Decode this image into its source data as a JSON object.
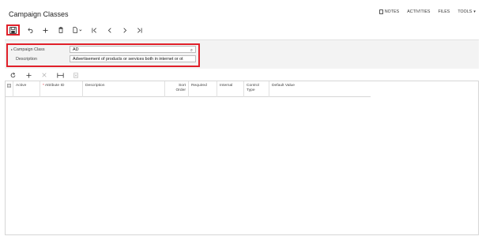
{
  "header": {
    "title": "Campaign Classes",
    "links": [
      {
        "label": "NOTES",
        "icon": "note-icon"
      },
      {
        "label": "ACTIVITIES"
      },
      {
        "label": "FILES"
      },
      {
        "label": "TOOLS",
        "caret": "▾"
      }
    ]
  },
  "toolbar": {
    "buttons": [
      {
        "name": "save-icon"
      },
      {
        "name": "undo-icon"
      },
      {
        "name": "add-icon"
      },
      {
        "name": "delete-icon"
      },
      {
        "name": "copy-paste-icon"
      },
      {
        "name": "first-record-icon"
      },
      {
        "name": "previous-record-icon"
      },
      {
        "name": "next-record-icon"
      },
      {
        "name": "last-record-icon"
      }
    ]
  },
  "form": {
    "campaign_class_label": "Campaign Class",
    "campaign_class_value": "AD",
    "description_label": "Description",
    "description_value": "Advertisement of products or services both in internet or ot"
  },
  "grid": {
    "columns": {
      "active": "Active",
      "attribute_id": "Attribute ID",
      "description": "Description",
      "sort_order_1": "Sort",
      "sort_order_2": "Order",
      "required": "Required",
      "internal": "Internal",
      "control_type_1": "Control",
      "control_type_2": "Type",
      "default_value": "Default Value"
    },
    "rows": []
  },
  "colors": {
    "highlight": "#e0202a",
    "form_bg": "#f3f3f3"
  }
}
